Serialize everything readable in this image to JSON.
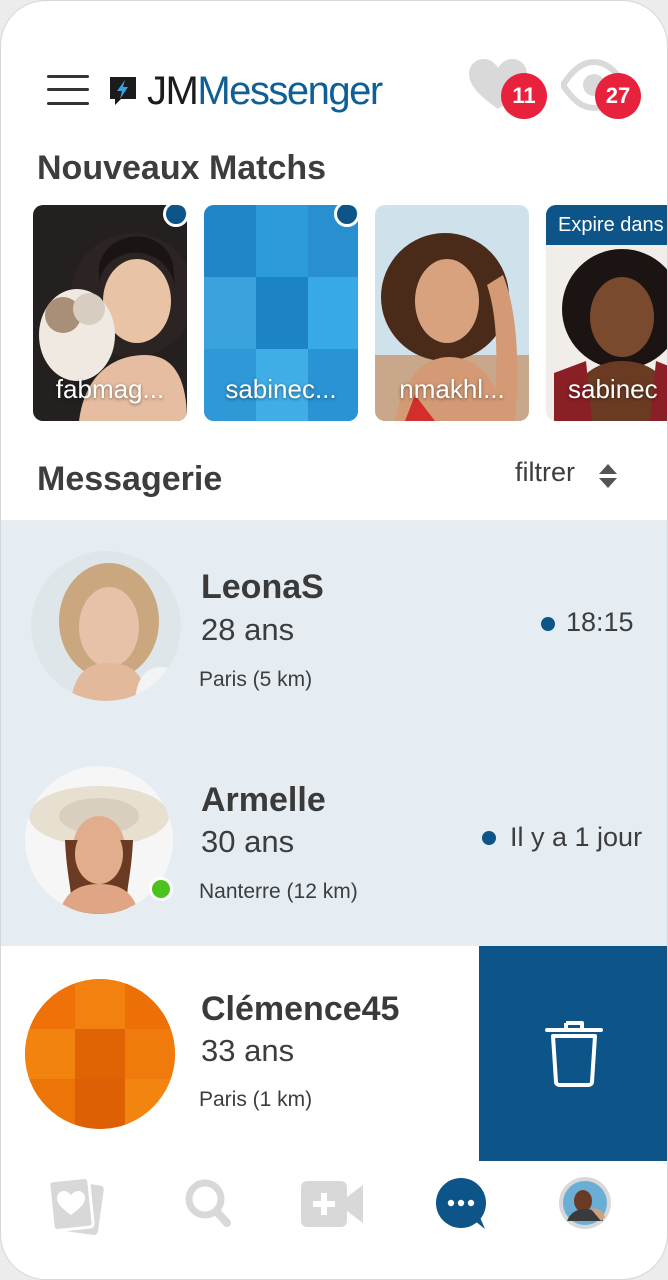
{
  "header": {
    "logo_part1": "JM",
    "logo_part2": "Messenger",
    "likes_count": "11",
    "views_count": "27",
    "icons": [
      "menu-icon",
      "logo-bolt-icon",
      "heart-icon",
      "eye-icon"
    ]
  },
  "matches": {
    "title": "Nouveaux Matchs",
    "items": [
      {
        "name": "fabmag..."
      },
      {
        "name": "sabinec..."
      },
      {
        "name": "nmakhl..."
      },
      {
        "name": "sabinec",
        "expire_label": "Expire dans"
      }
    ]
  },
  "inbox": {
    "title": "Messagerie",
    "filter_label": "filtrer",
    "conversations": [
      {
        "name": "LeonaS",
        "age": "28 ans",
        "location": "Paris (5 km)",
        "time": "18:15"
      },
      {
        "name": "Armelle",
        "age": "30 ans",
        "location": "Nanterre (12 km)",
        "time": "Il y a 1 jour"
      },
      {
        "name": "Clémence45",
        "age": "33 ans",
        "location": "Paris (1 km)"
      }
    ]
  },
  "nav": {
    "items": [
      "cards-heart-icon",
      "search-icon",
      "video-add-icon",
      "chat-icon",
      "profile-avatar"
    ],
    "active": "chat-icon"
  },
  "colors": {
    "brand": "#0d5488",
    "badge": "#e8213c",
    "unread_row": "#e5edf3",
    "online": "#4cc21d",
    "inactive_icon": "#d8d8d8"
  }
}
